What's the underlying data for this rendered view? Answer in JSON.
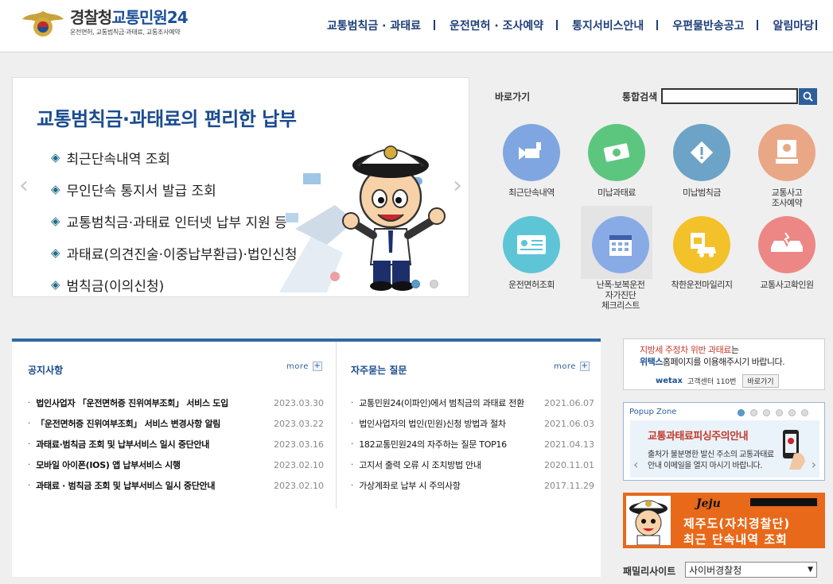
{
  "header": {
    "logo_title_1": "경찰청",
    "logo_title_2": "교통민원24",
    "logo_sub": "운전면허, 교통범칙금·과태료, 교통조사예약",
    "nav": [
      "교통범칙금 · 과태료",
      "운전면허 · 조사예약",
      "통지서비스안내",
      "우편물반송공고",
      "알림마당"
    ]
  },
  "visual": {
    "title": "교통범칙금·과태료의 편리한 납부",
    "items": [
      "최근단속내역 조회",
      "무인단속 통지서 발급 조회",
      "교통범칙금·과태료 인터넷 납부 지원 등",
      "과태료(의견진술·이중납부환급)·법인신청",
      "범칙금(이의신청)"
    ],
    "bullet": "◈",
    "prev": "‹",
    "next": "›"
  },
  "quick": {
    "label": "바로가기",
    "items": [
      {
        "label": "최근단속내역",
        "color": "#7fa6e0"
      },
      {
        "label": "미납과태료",
        "color": "#5cc67f"
      },
      {
        "label": "미납범칙금",
        "color": "#6da3c6"
      },
      {
        "label": "교통사고\n조사예약",
        "color": "#e9a785"
      },
      {
        "label": "운전면허조회",
        "color": "#5dc5d6"
      },
      {
        "label": "난폭·보복운전\n자가진단\n체크리스트",
        "color": "#88abe6"
      },
      {
        "label": "착한운전마일리지",
        "color": "#f3c12a"
      },
      {
        "label": "교통사고확인원",
        "color": "#ec8786"
      }
    ]
  },
  "search": {
    "label": "통합검색",
    "placeholder": ""
  },
  "notice": {
    "title": "공지사항",
    "more": "more",
    "items": [
      {
        "text": "법인사업자 「운전면허증 진위여부조회」 서비스 도입",
        "date": "2023.03.30"
      },
      {
        "text": "「운전면허증 진위여부조회」 서비스 변경사항 알림",
        "date": "2023.03.22"
      },
      {
        "text": "과태료·범칙금 조회 및 납부서비스 일시 중단안내",
        "date": "2023.03.16"
      },
      {
        "text": "모바일 아이폰(IOS) 앱 납부서비스 시행",
        "date": "2023.02.10"
      },
      {
        "text": "과태료 · 범칙금 조회 및 납부서비스 일시 중단안내",
        "date": "2023.02.10"
      }
    ]
  },
  "faq": {
    "title": "자주묻는 질문",
    "more": "more",
    "items": [
      {
        "text": "교통민원24(이파인)에서 범칙금의 과태료 전환",
        "date": "2021.06.07"
      },
      {
        "text": "법인사업자의 법인(민원)신청 방법과 절차",
        "date": "2021.06.03"
      },
      {
        "text": "182교통민원24의 자주하는 질문 TOP16",
        "date": "2021.04.13"
      },
      {
        "text": "고지서 출력 오류 시 조치방법 안내",
        "date": "2020.11.01"
      },
      {
        "text": "가상계좌로 납부 시 주의사항",
        "date": "2017.11.29"
      }
    ]
  },
  "wetax": {
    "line1_red": "지방세 주정차 위반 과태료",
    "line1_rest": "는",
    "line2_bold": "위택스",
    "line2_rest": "홈페이지를 이용해주시기 바랍니다.",
    "brand": "wetax",
    "center": "고객센터 110번",
    "button": "바로가기"
  },
  "popup": {
    "title": "Popup Zone",
    "headline": "교통과태료피싱주의안내",
    "text1": "출처가 불분명한 발신 주소의 교통과태료",
    "text2": "안내 이메일을 열지 마시기 바랍니다."
  },
  "jeju": {
    "script": "Jeju",
    "line1": "제주도(자치경찰단)",
    "line2": "최근 단속내역 조회"
  },
  "family": {
    "label": "패밀리사이트",
    "selected": "사이버경찰청"
  }
}
